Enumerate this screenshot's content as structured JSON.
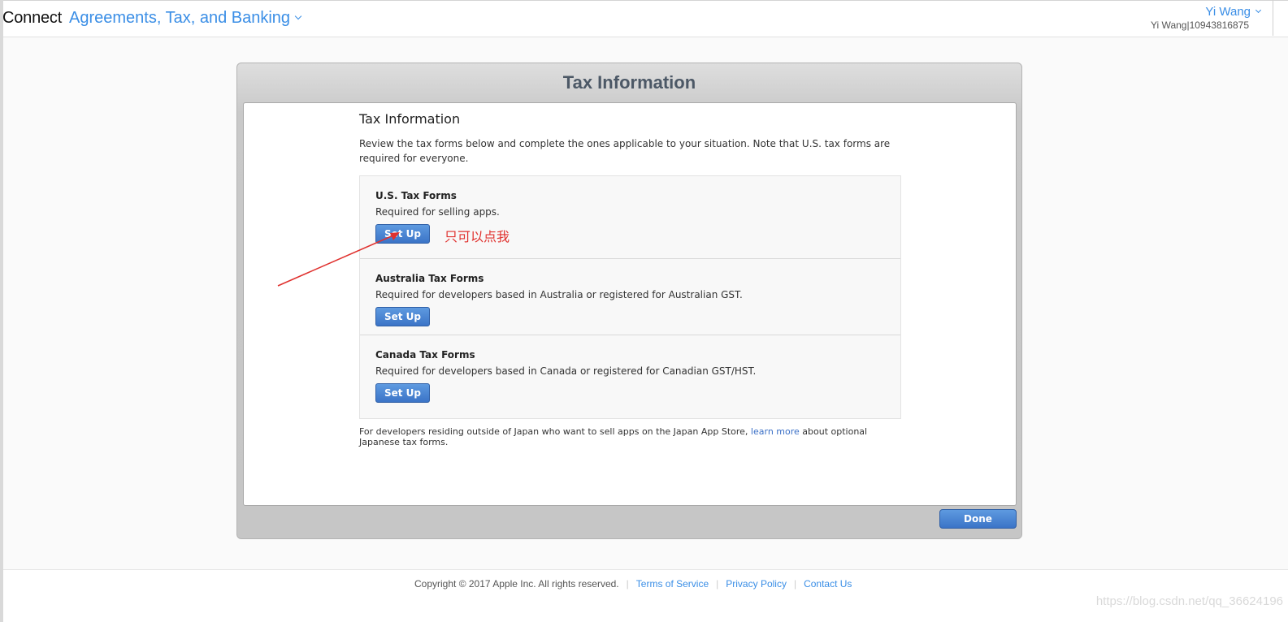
{
  "header": {
    "brand": "Connect",
    "section": "Agreements, Tax, and Banking",
    "user_name": "Yi Wang",
    "user_account": "Yi Wang|10943816875"
  },
  "dialog": {
    "title": "Tax Information",
    "content_title": "Tax Information",
    "intro": "Review the tax forms below and complete the ones applicable to your situation. Note that U.S. tax forms are required for everyone.",
    "forms": [
      {
        "name": "U.S. Tax Forms",
        "description": "Required for selling apps.",
        "button": "Set Up"
      },
      {
        "name": "Australia Tax Forms",
        "description": "Required for developers based in Australia or registered for Australian GST.",
        "button": "Set Up"
      },
      {
        "name": "Canada Tax Forms",
        "description": "Required for developers based in Canada or registered for Canadian GST/HST.",
        "button": "Set Up"
      }
    ],
    "footnote_before": "For developers residing outside of Japan who want to sell apps on the Japan App Store, ",
    "footnote_link": "learn more",
    "footnote_after": " about optional Japanese tax forms.",
    "done_button": "Done"
  },
  "annotation": {
    "text": "只可以点我",
    "color": "#e0322f"
  },
  "footer": {
    "copyright": "Copyright © 2017 Apple Inc. All rights reserved.",
    "links": [
      "Terms of Service",
      "Privacy Policy",
      "Contact Us"
    ]
  },
  "watermark": "https://blog.csdn.net/qq_36624196",
  "colors": {
    "accent": "#3a8ee6",
    "button": "#3b74c7",
    "title": "#4c5866"
  }
}
